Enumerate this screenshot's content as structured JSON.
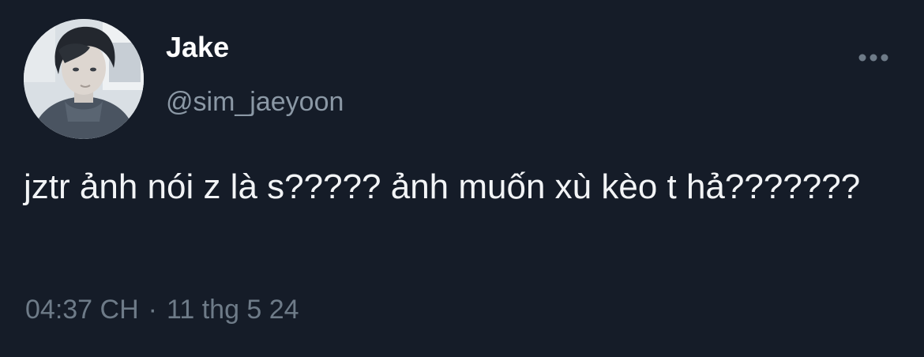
{
  "author": {
    "display_name": "Jake",
    "handle": "@sim_jaeyoon",
    "avatar_icon": "profile-photo"
  },
  "menu": {
    "more_icon": "more-horizontal-icon"
  },
  "tweet": {
    "text": "jztr ảnh nói z là s????? ảnh muốn xù kèo t hả???????"
  },
  "meta": {
    "time": "04:37 CH",
    "separator": "·",
    "date": "11 thg 5 24"
  },
  "colors": {
    "background": "#151c28",
    "primary_text": "#ffffff",
    "secondary_text": "#8b98a5",
    "meta_text": "#6e7b88"
  }
}
